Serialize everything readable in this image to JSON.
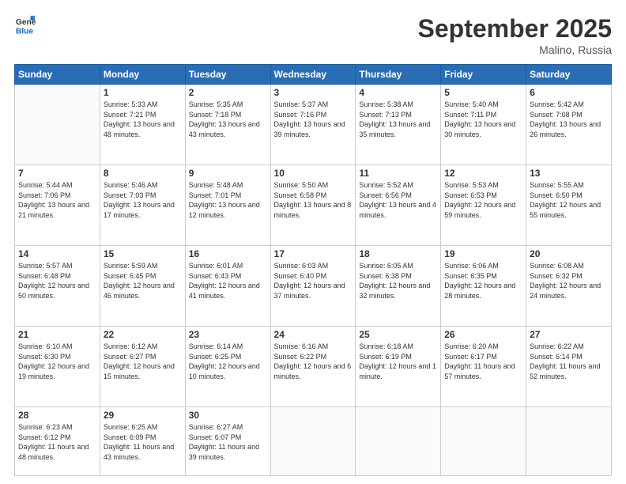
{
  "header": {
    "logo_line1": "General",
    "logo_line2": "Blue",
    "month_year": "September 2025",
    "location": "Malino, Russia"
  },
  "days_of_week": [
    "Sunday",
    "Monday",
    "Tuesday",
    "Wednesday",
    "Thursday",
    "Friday",
    "Saturday"
  ],
  "weeks": [
    [
      {
        "day": "",
        "sunrise": "",
        "sunset": "",
        "daylight": ""
      },
      {
        "day": "1",
        "sunrise": "Sunrise: 5:33 AM",
        "sunset": "Sunset: 7:21 PM",
        "daylight": "Daylight: 13 hours and 48 minutes."
      },
      {
        "day": "2",
        "sunrise": "Sunrise: 5:35 AM",
        "sunset": "Sunset: 7:18 PM",
        "daylight": "Daylight: 13 hours and 43 minutes."
      },
      {
        "day": "3",
        "sunrise": "Sunrise: 5:37 AM",
        "sunset": "Sunset: 7:16 PM",
        "daylight": "Daylight: 13 hours and 39 minutes."
      },
      {
        "day": "4",
        "sunrise": "Sunrise: 5:38 AM",
        "sunset": "Sunset: 7:13 PM",
        "daylight": "Daylight: 13 hours and 35 minutes."
      },
      {
        "day": "5",
        "sunrise": "Sunrise: 5:40 AM",
        "sunset": "Sunset: 7:11 PM",
        "daylight": "Daylight: 13 hours and 30 minutes."
      },
      {
        "day": "6",
        "sunrise": "Sunrise: 5:42 AM",
        "sunset": "Sunset: 7:08 PM",
        "daylight": "Daylight: 13 hours and 26 minutes."
      }
    ],
    [
      {
        "day": "7",
        "sunrise": "Sunrise: 5:44 AM",
        "sunset": "Sunset: 7:06 PM",
        "daylight": "Daylight: 13 hours and 21 minutes."
      },
      {
        "day": "8",
        "sunrise": "Sunrise: 5:46 AM",
        "sunset": "Sunset: 7:03 PM",
        "daylight": "Daylight: 13 hours and 17 minutes."
      },
      {
        "day": "9",
        "sunrise": "Sunrise: 5:48 AM",
        "sunset": "Sunset: 7:01 PM",
        "daylight": "Daylight: 13 hours and 12 minutes."
      },
      {
        "day": "10",
        "sunrise": "Sunrise: 5:50 AM",
        "sunset": "Sunset: 6:58 PM",
        "daylight": "Daylight: 13 hours and 8 minutes."
      },
      {
        "day": "11",
        "sunrise": "Sunrise: 5:52 AM",
        "sunset": "Sunset: 6:56 PM",
        "daylight": "Daylight: 13 hours and 4 minutes."
      },
      {
        "day": "12",
        "sunrise": "Sunrise: 5:53 AM",
        "sunset": "Sunset: 6:53 PM",
        "daylight": "Daylight: 12 hours and 59 minutes."
      },
      {
        "day": "13",
        "sunrise": "Sunrise: 5:55 AM",
        "sunset": "Sunset: 6:50 PM",
        "daylight": "Daylight: 12 hours and 55 minutes."
      }
    ],
    [
      {
        "day": "14",
        "sunrise": "Sunrise: 5:57 AM",
        "sunset": "Sunset: 6:48 PM",
        "daylight": "Daylight: 12 hours and 50 minutes."
      },
      {
        "day": "15",
        "sunrise": "Sunrise: 5:59 AM",
        "sunset": "Sunset: 6:45 PM",
        "daylight": "Daylight: 12 hours and 46 minutes."
      },
      {
        "day": "16",
        "sunrise": "Sunrise: 6:01 AM",
        "sunset": "Sunset: 6:43 PM",
        "daylight": "Daylight: 12 hours and 41 minutes."
      },
      {
        "day": "17",
        "sunrise": "Sunrise: 6:03 AM",
        "sunset": "Sunset: 6:40 PM",
        "daylight": "Daylight: 12 hours and 37 minutes."
      },
      {
        "day": "18",
        "sunrise": "Sunrise: 6:05 AM",
        "sunset": "Sunset: 6:38 PM",
        "daylight": "Daylight: 12 hours and 32 minutes."
      },
      {
        "day": "19",
        "sunrise": "Sunrise: 6:06 AM",
        "sunset": "Sunset: 6:35 PM",
        "daylight": "Daylight: 12 hours and 28 minutes."
      },
      {
        "day": "20",
        "sunrise": "Sunrise: 6:08 AM",
        "sunset": "Sunset: 6:32 PM",
        "daylight": "Daylight: 12 hours and 24 minutes."
      }
    ],
    [
      {
        "day": "21",
        "sunrise": "Sunrise: 6:10 AM",
        "sunset": "Sunset: 6:30 PM",
        "daylight": "Daylight: 12 hours and 19 minutes."
      },
      {
        "day": "22",
        "sunrise": "Sunrise: 6:12 AM",
        "sunset": "Sunset: 6:27 PM",
        "daylight": "Daylight: 12 hours and 15 minutes."
      },
      {
        "day": "23",
        "sunrise": "Sunrise: 6:14 AM",
        "sunset": "Sunset: 6:25 PM",
        "daylight": "Daylight: 12 hours and 10 minutes."
      },
      {
        "day": "24",
        "sunrise": "Sunrise: 6:16 AM",
        "sunset": "Sunset: 6:22 PM",
        "daylight": "Daylight: 12 hours and 6 minutes."
      },
      {
        "day": "25",
        "sunrise": "Sunrise: 6:18 AM",
        "sunset": "Sunset: 6:19 PM",
        "daylight": "Daylight: 12 hours and 1 minute."
      },
      {
        "day": "26",
        "sunrise": "Sunrise: 6:20 AM",
        "sunset": "Sunset: 6:17 PM",
        "daylight": "Daylight: 11 hours and 57 minutes."
      },
      {
        "day": "27",
        "sunrise": "Sunrise: 6:22 AM",
        "sunset": "Sunset: 6:14 PM",
        "daylight": "Daylight: 11 hours and 52 minutes."
      }
    ],
    [
      {
        "day": "28",
        "sunrise": "Sunrise: 6:23 AM",
        "sunset": "Sunset: 6:12 PM",
        "daylight": "Daylight: 11 hours and 48 minutes."
      },
      {
        "day": "29",
        "sunrise": "Sunrise: 6:25 AM",
        "sunset": "Sunset: 6:09 PM",
        "daylight": "Daylight: 11 hours and 43 minutes."
      },
      {
        "day": "30",
        "sunrise": "Sunrise: 6:27 AM",
        "sunset": "Sunset: 6:07 PM",
        "daylight": "Daylight: 11 hours and 39 minutes."
      },
      {
        "day": "",
        "sunrise": "",
        "sunset": "",
        "daylight": ""
      },
      {
        "day": "",
        "sunrise": "",
        "sunset": "",
        "daylight": ""
      },
      {
        "day": "",
        "sunrise": "",
        "sunset": "",
        "daylight": ""
      },
      {
        "day": "",
        "sunrise": "",
        "sunset": "",
        "daylight": ""
      }
    ]
  ]
}
